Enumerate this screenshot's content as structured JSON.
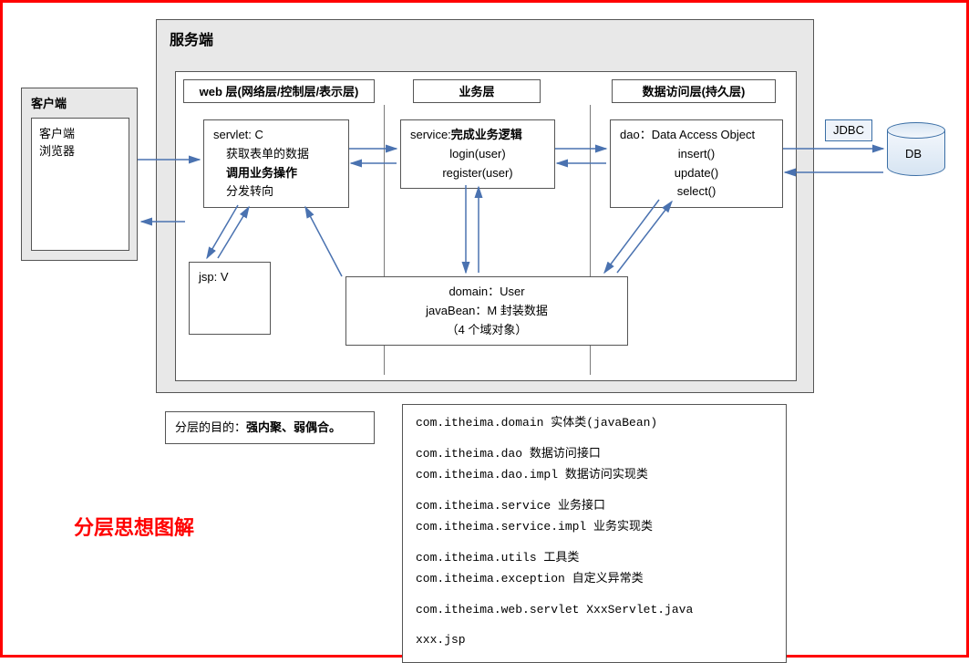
{
  "client": {
    "title": "客户端",
    "line1": "客户端",
    "line2": "浏览器"
  },
  "server": {
    "title": "服务端",
    "layers": {
      "web": {
        "title": "web 层(网络层/控制层/表示层)"
      },
      "biz": {
        "title": "业务层"
      },
      "dao": {
        "title": "数据访问层(持久层)"
      }
    },
    "servlet": {
      "l1": "servlet: C",
      "l2": "获取表单的数据",
      "l3": "调用业务操作",
      "l4": "分发转向"
    },
    "jsp": {
      "label": "jsp: V"
    },
    "service": {
      "l1": "service:完成业务逻辑",
      "l2": "login(user)",
      "l3": "register(user)"
    },
    "dao_box": {
      "l1": "dao：Data Access Object",
      "l2": "insert()",
      "l3": "update()",
      "l4": "select()"
    },
    "domain": {
      "l1": "domain：User",
      "l2": "javaBean：M 封装数据",
      "l3": "（4 个域对象）"
    }
  },
  "db": {
    "jdbc": "JDBC",
    "label": "DB"
  },
  "purpose": {
    "prefix": "分层的目的：",
    "bold": "强内聚、弱偶合。"
  },
  "packages": {
    "p1": "com.itheima.domain   实体类(javaBean)",
    "p2": "com.itheima.dao   数据访问接口",
    "p3": "com.itheima.dao.impl   数据访问实现类",
    "p4": "com.itheima.service   业务接口",
    "p5": "com.itheima.service.impl   业务实现类",
    "p6": "com.itheima.utils   工具类",
    "p7": "com.itheima.exception   自定义异常类",
    "p8": "com.itheima.web.servlet   XxxServlet.java",
    "p9": "xxx.jsp"
  },
  "main_label": "分层思想图解"
}
